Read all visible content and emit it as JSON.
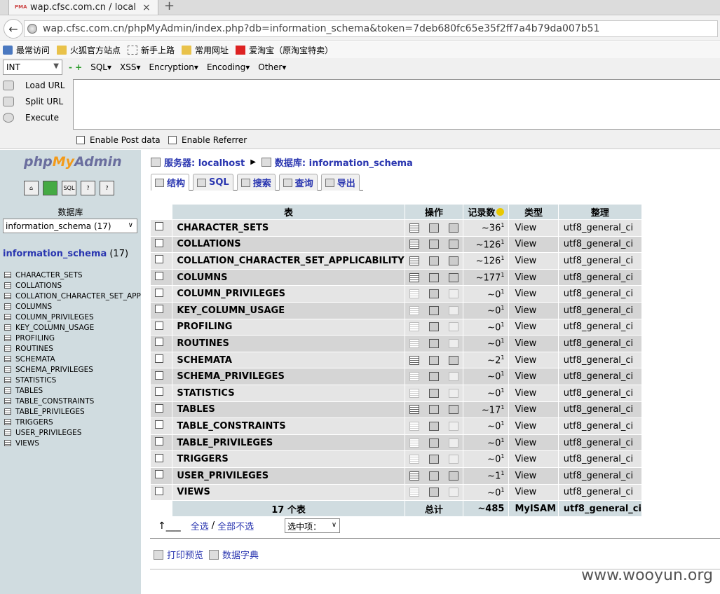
{
  "browser": {
    "tab_title": "wap.cfsc.com.cn / local...",
    "tab_logo": "PMA",
    "tab_close": "×",
    "new_tab": "+",
    "url": "wap.cfsc.com.cn/phpMyAdmin/index.php?db=information_schema&token=7deb680fc65e35f2ff7a4b79da007b51",
    "bookmarks": [
      "最常访问",
      "火狐官方站点",
      "新手上路",
      "常用网址",
      "爱淘宝（原淘宝特卖）"
    ]
  },
  "hackbar": {
    "select_value": "INT",
    "menu": [
      "SQL▾",
      "XSS▾",
      "Encryption▾",
      "Encoding▾",
      "Other▾"
    ],
    "buttons": [
      "Load URL",
      "Split URL",
      "Execute"
    ],
    "enable_post": "Enable Post data",
    "enable_referrer": "Enable Referrer"
  },
  "sidebar": {
    "brand_php": "php",
    "brand_my": "My",
    "brand_admin": "Admin",
    "db_label": "数据库",
    "db_select": "information_schema (17)",
    "current_db": "information_schema",
    "current_count": "(17)",
    "tables": [
      "CHARACTER_SETS",
      "COLLATIONS",
      "COLLATION_CHARACTER_SET_APPLICABILITY",
      "COLUMNS",
      "COLUMN_PRIVILEGES",
      "KEY_COLUMN_USAGE",
      "PROFILING",
      "ROUTINES",
      "SCHEMATA",
      "SCHEMA_PRIVILEGES",
      "STATISTICS",
      "TABLES",
      "TABLE_CONSTRAINTS",
      "TABLE_PRIVILEGES",
      "TRIGGERS",
      "USER_PRIVILEGES",
      "VIEWS"
    ]
  },
  "main": {
    "server": "服务器: localhost",
    "database": "数据库: information_schema",
    "tabs": [
      "结构",
      "SQL",
      "搜索",
      "查询",
      "导出"
    ],
    "headers": [
      "表",
      "操作",
      "记录数",
      "类型",
      "整理"
    ],
    "rows": [
      {
        "name": "CHARACTER_SETS",
        "rows": "~36",
        "type": "View",
        "coll": "utf8_general_ci",
        "full": true
      },
      {
        "name": "COLLATIONS",
        "rows": "~126",
        "type": "View",
        "coll": "utf8_general_ci",
        "full": true
      },
      {
        "name": "COLLATION_CHARACTER_SET_APPLICABILITY",
        "rows": "~126",
        "type": "View",
        "coll": "utf8_general_ci",
        "full": true
      },
      {
        "name": "COLUMNS",
        "rows": "~177",
        "type": "View",
        "coll": "utf8_general_ci",
        "full": true
      },
      {
        "name": "COLUMN_PRIVILEGES",
        "rows": "~0",
        "type": "View",
        "coll": "utf8_general_ci",
        "full": false
      },
      {
        "name": "KEY_COLUMN_USAGE",
        "rows": "~0",
        "type": "View",
        "coll": "utf8_general_ci",
        "full": false
      },
      {
        "name": "PROFILING",
        "rows": "~0",
        "type": "View",
        "coll": "utf8_general_ci",
        "full": false
      },
      {
        "name": "ROUTINES",
        "rows": "~0",
        "type": "View",
        "coll": "utf8_general_ci",
        "full": false
      },
      {
        "name": "SCHEMATA",
        "rows": "~2",
        "type": "View",
        "coll": "utf8_general_ci",
        "full": true
      },
      {
        "name": "SCHEMA_PRIVILEGES",
        "rows": "~0",
        "type": "View",
        "coll": "utf8_general_ci",
        "full": false
      },
      {
        "name": "STATISTICS",
        "rows": "~0",
        "type": "View",
        "coll": "utf8_general_ci",
        "full": false
      },
      {
        "name": "TABLES",
        "rows": "~17",
        "type": "View",
        "coll": "utf8_general_ci",
        "full": true
      },
      {
        "name": "TABLE_CONSTRAINTS",
        "rows": "~0",
        "type": "View",
        "coll": "utf8_general_ci",
        "full": false
      },
      {
        "name": "TABLE_PRIVILEGES",
        "rows": "~0",
        "type": "View",
        "coll": "utf8_general_ci",
        "full": false
      },
      {
        "name": "TRIGGERS",
        "rows": "~0",
        "type": "View",
        "coll": "utf8_general_ci",
        "full": false
      },
      {
        "name": "USER_PRIVILEGES",
        "rows": "~1",
        "type": "View",
        "coll": "utf8_general_ci",
        "full": true
      },
      {
        "name": "VIEWS",
        "rows": "~0",
        "type": "View",
        "coll": "utf8_general_ci",
        "full": false
      }
    ],
    "footer": {
      "count": "17 个表",
      "total": "总计",
      "rows": "~485",
      "type": "MyISAM",
      "coll": "utf8_general_ci"
    },
    "check_all": "全选",
    "uncheck_all": "全部不选",
    "with_selected": "选中项：",
    "print_view": "打印预览",
    "data_dict": "数据字典"
  },
  "watermark": "www.wooyun.org"
}
